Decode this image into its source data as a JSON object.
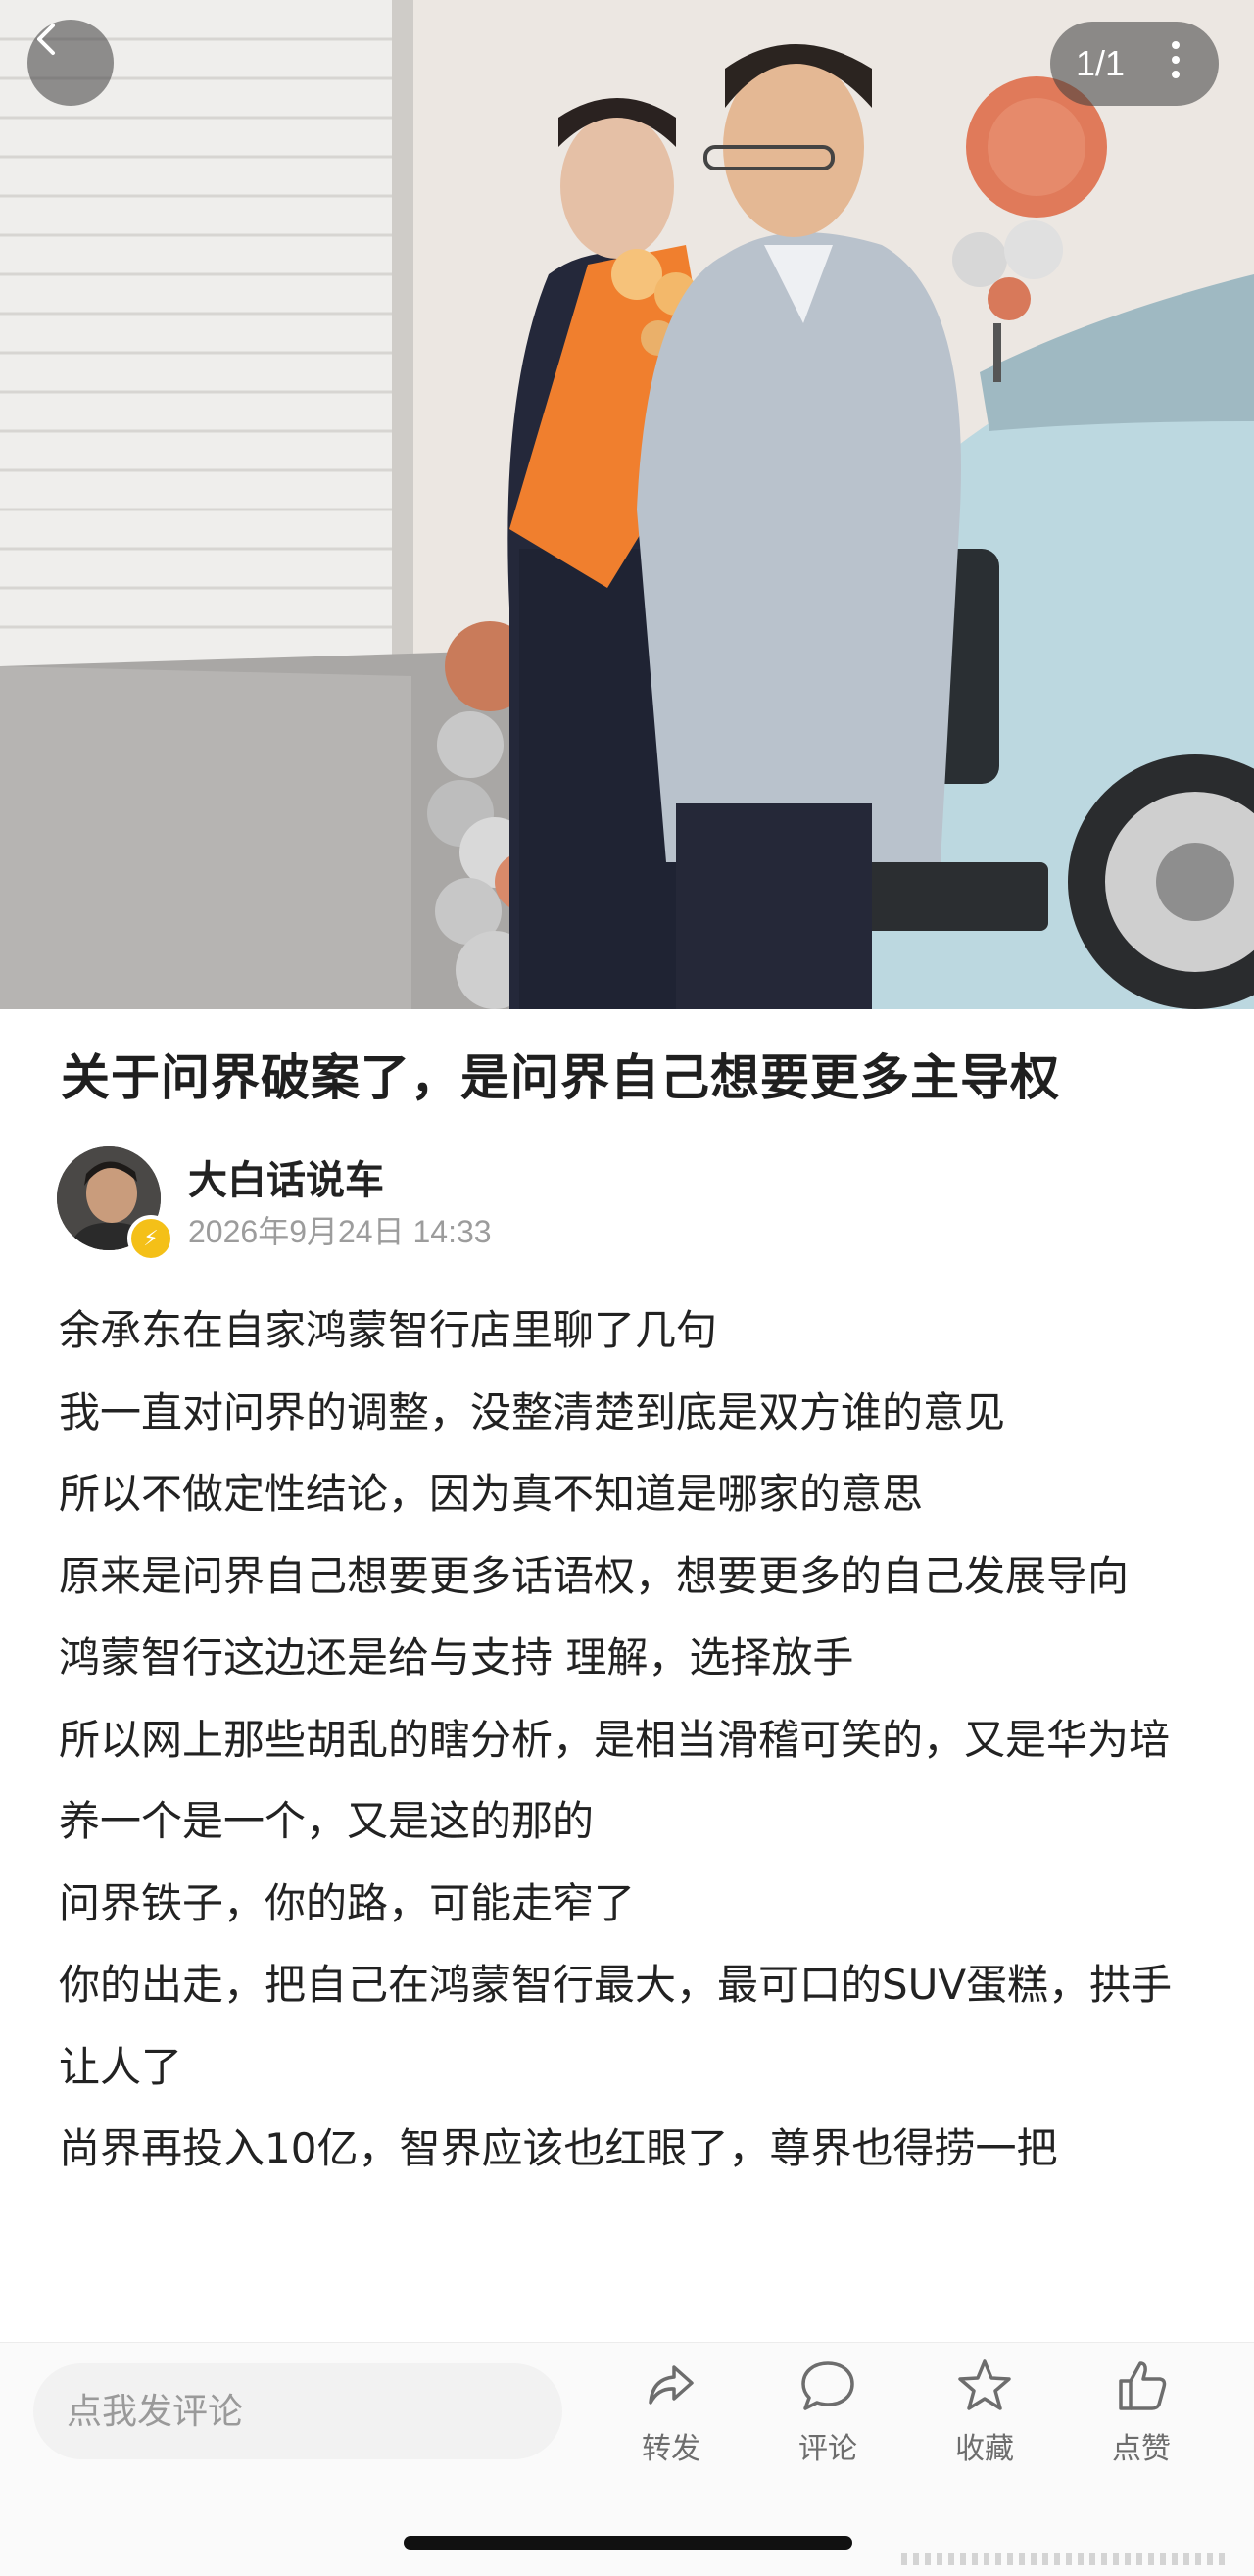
{
  "viewer": {
    "counter": "1/1"
  },
  "article": {
    "title": "关于问界破案了，是问界自己想要更多主导权",
    "author": "大白话说车",
    "date": "2026年9月24日 14:33",
    "paragraphs": [
      "余承东在自家鸿蒙智行店里聊了几句",
      "我一直对问界的调整，没整清楚到底是双方谁的意见",
      "所以不做定性结论，因为真不知道是哪家的意思",
      "原来是问界自己想要更多话语权，想要更多的自己发展导向",
      "鸿蒙智行这边还是给与支持 理解，选择放手",
      "所以网上那些胡乱的瞎分析，是相当滑稽可笑的，又是华为培养一个是一个，又是这的那的",
      "问界铁子，你的路，可能走窄了",
      "你的出走，把自己在鸿蒙智行最大，最可口的SUV蛋糕，拱手让人了",
      "尚界再投入10亿，智界应该也红眼了，尊界也得捞一把"
    ]
  },
  "bottom_bar": {
    "comment_placeholder": "点我发评论",
    "actions": [
      {
        "label": "转发",
        "icon": "share-icon"
      },
      {
        "label": "评论",
        "icon": "comment-icon"
      },
      {
        "label": "收藏",
        "icon": "star-icon"
      },
      {
        "label": "点赞",
        "icon": "thumbs-up-icon"
      }
    ]
  },
  "colors": {
    "verified_badge": "#f4c018",
    "date_gray": "#9c9c9c",
    "action_gray": "#6d6d6d"
  }
}
